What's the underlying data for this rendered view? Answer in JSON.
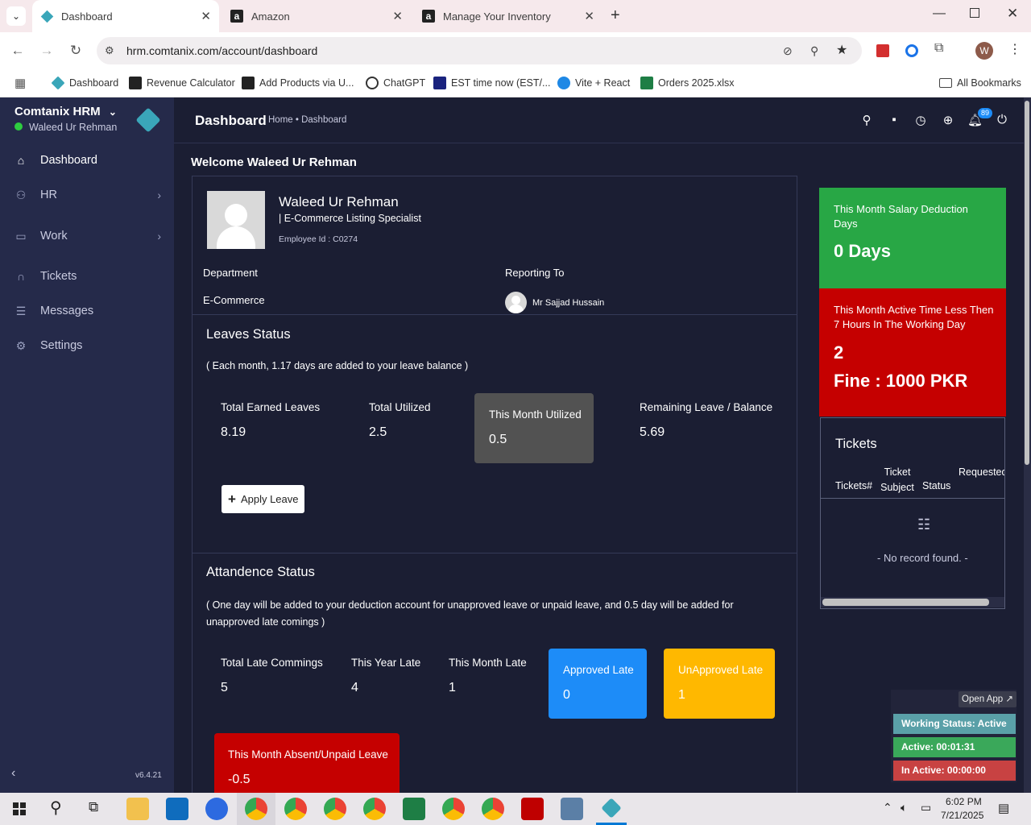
{
  "browser": {
    "tabs": [
      {
        "title": "Dashboard",
        "icon": "comtanix-icon"
      },
      {
        "title": "Amazon",
        "icon": "amazon-icon"
      },
      {
        "title": "Manage Your Inventory",
        "icon": "amazon-icon"
      }
    ],
    "url": "hrm.comtanix.com/account/dashboard",
    "bookmarks": [
      "Dashboard",
      "Revenue Calculator",
      "Add Products via U...",
      "ChatGPT",
      "EST time now (EST/...",
      "Vite + React",
      "Orders 2025.xlsx"
    ],
    "all_bookmarks": "All Bookmarks",
    "profile_initial": "W"
  },
  "sidebar": {
    "brand": "Comtanix HRM",
    "user": "Waleed Ur Rehman",
    "items": [
      {
        "label": "Dashboard",
        "icon": "home-icon"
      },
      {
        "label": "HR",
        "icon": "users-icon"
      },
      {
        "label": "Work",
        "icon": "briefcase-icon"
      },
      {
        "label": "Tickets",
        "icon": "headset-icon"
      },
      {
        "label": "Messages",
        "icon": "message-icon"
      },
      {
        "label": "Settings",
        "icon": "gear-icon"
      }
    ],
    "version": "v6.4.21"
  },
  "header": {
    "title": "Dashboard",
    "breadcrumb": "Home • Dashboard",
    "notification_count": "89"
  },
  "welcome": "Welcome Waleed Ur Rehman",
  "profile": {
    "name": "Waleed Ur Rehman",
    "role": "| E-Commerce Listing Specialist",
    "employee_id": "Employee Id : C0274",
    "department_label": "Department",
    "department": "E-Commerce",
    "reporting_label": "Reporting To",
    "reporting_to": "Mr Sajjad Hussain"
  },
  "leaves": {
    "title": "Leaves Status",
    "note": "( Each month, 1.17 days are added to your leave balance )",
    "stats": [
      {
        "label": "Total Earned Leaves",
        "value": "8.19"
      },
      {
        "label": "Total Utilized",
        "value": "2.5"
      },
      {
        "label": "This Month Utilized",
        "value": "0.5"
      },
      {
        "label": "Remaining Leave / Balance",
        "value": "5.69"
      }
    ],
    "apply_button": "Apply Leave"
  },
  "attendance": {
    "title": "Attandence Status",
    "note": "( One day will be added to your deduction account for unapproved leave or unpaid leave, and 0.5 day will be added for unapproved late comings )",
    "stats": [
      {
        "label": "Total Late Commings",
        "value": "5"
      },
      {
        "label": "This Year Late",
        "value": "4"
      },
      {
        "label": "This Month Late",
        "value": "1"
      },
      {
        "label": "Approved Late",
        "value": "0"
      },
      {
        "label": "UnApproved Late",
        "value": "1"
      }
    ],
    "absent": {
      "label": "This Month Absent/Unpaid Leave",
      "value": "-0.5"
    }
  },
  "right": {
    "salary": {
      "label": "This Month Salary Deduction Days",
      "value": "0 Days"
    },
    "active_time": {
      "label": "This Month Active Time Less Then 7 Hours In The Working Day",
      "value": "2",
      "fine": "Fine : 1000 PKR"
    },
    "tickets": {
      "title": "Tickets",
      "columns": [
        "Tickets#",
        "Ticket Subject",
        "Status",
        "Requested On"
      ],
      "empty": "- No record found. -"
    }
  },
  "widget": {
    "open_app": "Open App ↗",
    "working_status": "Working Status: Active",
    "active": "Active: 00:01:31",
    "inactive": "In Active: 00:00:00"
  },
  "taskbar": {
    "time": "6:02 PM",
    "date": "7/21/2025"
  },
  "colors": {
    "green": "#28a745",
    "red": "#c50000",
    "blue": "#1d8cf8",
    "yellow": "#ffb800",
    "sidebar": "#252a4a",
    "bg": "#1b1e33"
  }
}
